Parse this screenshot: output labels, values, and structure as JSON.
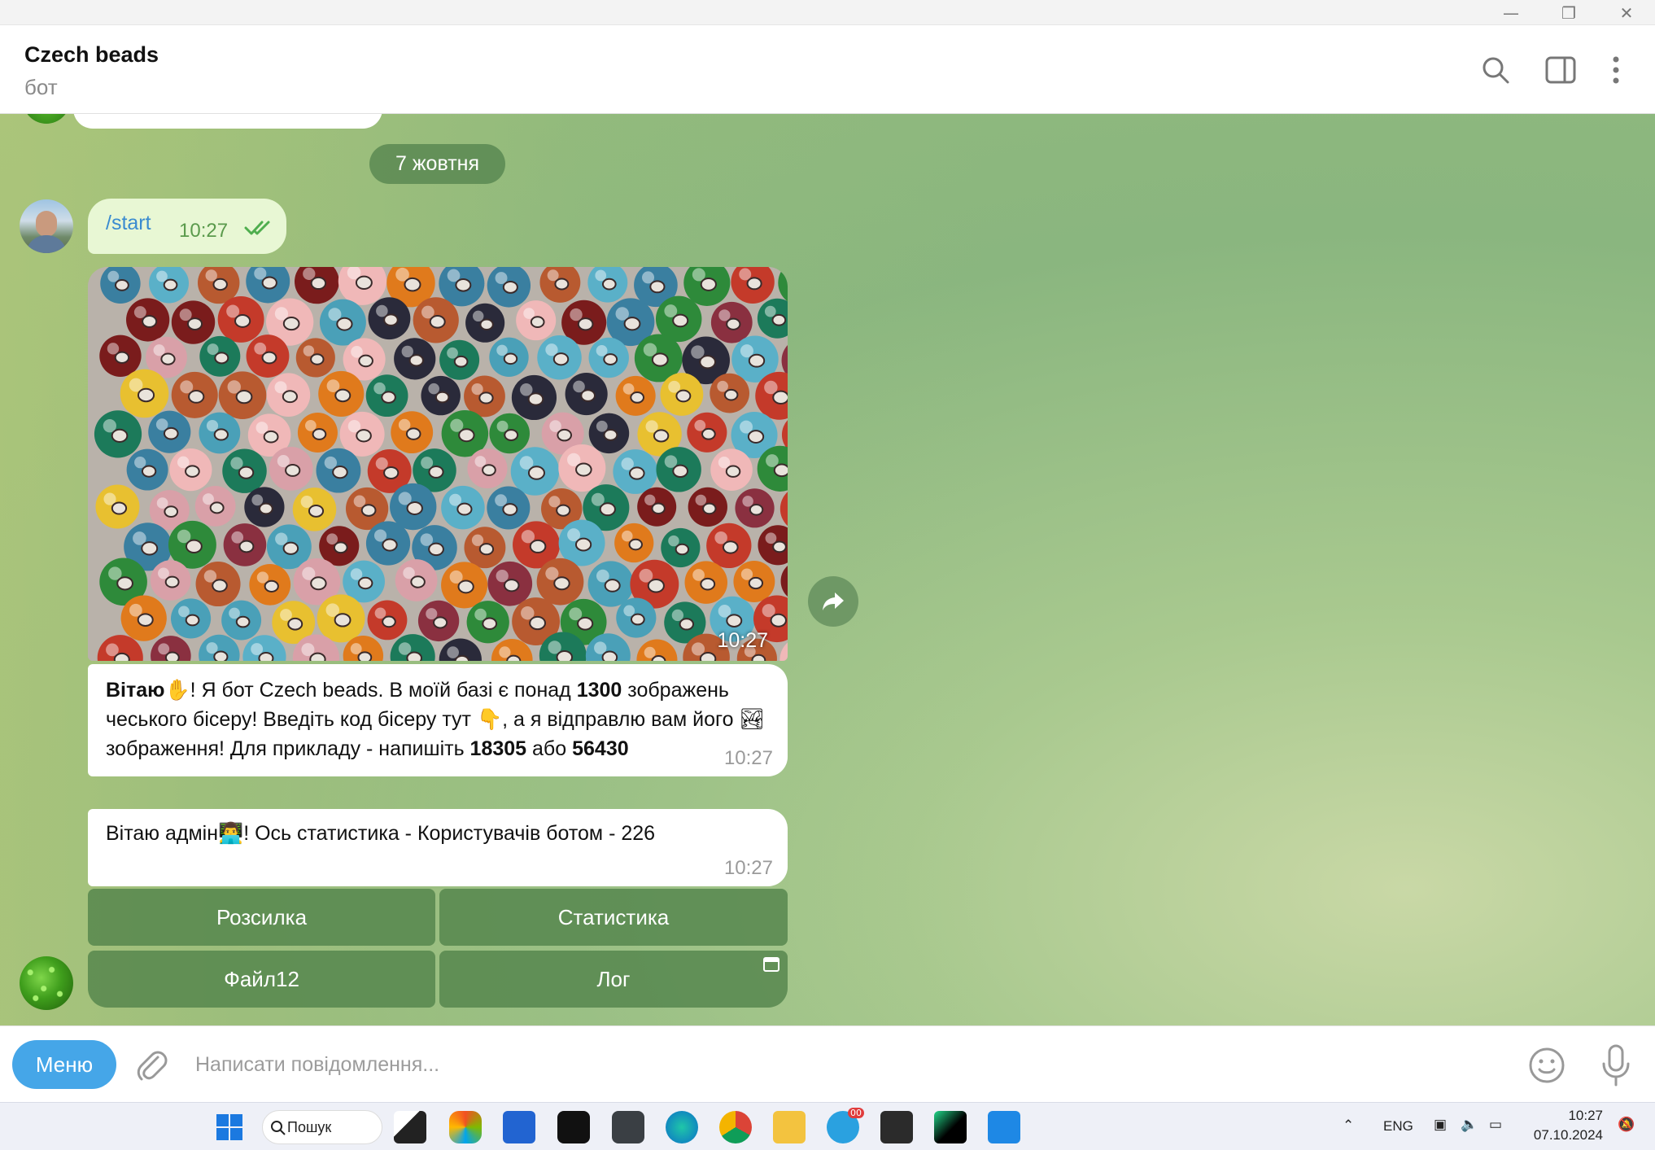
{
  "window": {
    "minimize_glyph": "—",
    "maximize_glyph": "❐",
    "close_glyph": "✕"
  },
  "chat": {
    "title": "Czech beads",
    "subtitle": "бот"
  },
  "date_separator": "7 жовтня",
  "outgoing": {
    "text": "/start",
    "time": "10:27",
    "status": "read"
  },
  "photo_message": {
    "time": "10:27",
    "description": "colorful ceramic beads"
  },
  "message1": {
    "parts": [
      {
        "text": "Вітаю",
        "bold": true
      },
      {
        "text": "✋",
        "emoji": true
      },
      {
        "text": "! Я бот Czech beads. В моїй базі є понад ",
        "bold": false
      },
      {
        "text": "1300",
        "bold": true
      },
      {
        "text": " зображень чеського бісеру! Введіть код бісеру тут ",
        "bold": false
      },
      {
        "text": "👇",
        "emoji": true
      },
      {
        "text": ", а я відправлю вам його ",
        "bold": false
      },
      {
        "text": "🏞",
        "emoji": true
      },
      {
        "text": " зображення! Для прикладу - напишіть ",
        "bold": false
      },
      {
        "text": "18305",
        "bold": true
      },
      {
        "text": " або ",
        "bold": false
      },
      {
        "text": "56430",
        "bold": true
      }
    ],
    "time": "10:27"
  },
  "message2": {
    "text_before": "Вітаю адмін",
    "emoji": "👨‍💻",
    "text_after": "! Ось статистика - Користувачів ботом - 226",
    "time": "10:27"
  },
  "keyboard": [
    [
      "Розсилка",
      "Статистика"
    ],
    [
      "Файл12",
      "Лог"
    ]
  ],
  "composer": {
    "menu_label": "Меню",
    "placeholder": "Написати повідомлення..."
  },
  "taskbar": {
    "search_label": "Пошук",
    "language": "ENG",
    "time": "10:27",
    "date": "07.10.2024",
    "telegram_badge": "00"
  },
  "colors": {
    "accent": "#45a6e8",
    "bubble_out": "#e8f7d4",
    "keyboard_btn": "#4f8249"
  }
}
